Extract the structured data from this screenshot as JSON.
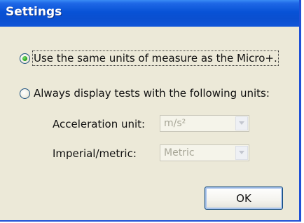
{
  "window": {
    "title": "Settings"
  },
  "options": {
    "same_units_label": "Use the same units of measure as the Micro+.",
    "same_units_selected": true,
    "custom_units_label": "Always display tests with the following units:",
    "custom_units_selected": false
  },
  "fields": {
    "acceleration": {
      "label": "Acceleration unit:",
      "value": "m/s²"
    },
    "imperial_metric": {
      "label": "Imperial/metric:",
      "value": "Metric"
    }
  },
  "buttons": {
    "ok_label": "OK"
  }
}
